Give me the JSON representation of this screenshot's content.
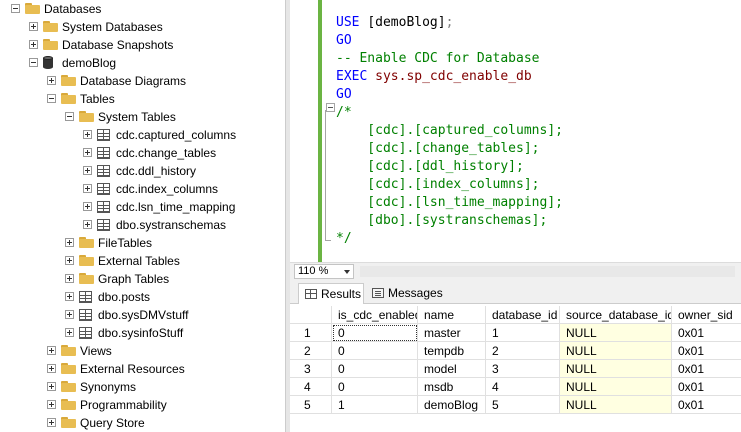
{
  "tree": {
    "items": [
      {
        "label": "Databases",
        "expander": "minus",
        "icon": "folder"
      },
      {
        "label": "System Databases",
        "expander": "plus",
        "icon": "folder"
      },
      {
        "label": "Database Snapshots",
        "expander": "plus",
        "icon": "folder"
      },
      {
        "label": "demoBlog",
        "expander": "minus",
        "icon": "database"
      },
      {
        "label": "Database Diagrams",
        "expander": "plus",
        "icon": "folder"
      },
      {
        "label": "Tables",
        "expander": "minus",
        "icon": "folder"
      },
      {
        "label": "System Tables",
        "expander": "minus",
        "icon": "folder"
      },
      {
        "label": "cdc.captured_columns",
        "expander": "plus",
        "icon": "table"
      },
      {
        "label": "cdc.change_tables",
        "expander": "plus",
        "icon": "table"
      },
      {
        "label": "cdc.ddl_history",
        "expander": "plus",
        "icon": "table"
      },
      {
        "label": "cdc.index_columns",
        "expander": "plus",
        "icon": "table"
      },
      {
        "label": "cdc.lsn_time_mapping",
        "expander": "plus",
        "icon": "table"
      },
      {
        "label": "dbo.systranschemas",
        "expander": "plus",
        "icon": "table"
      },
      {
        "label": "FileTables",
        "expander": "plus",
        "icon": "folder"
      },
      {
        "label": "External Tables",
        "expander": "plus",
        "icon": "folder"
      },
      {
        "label": "Graph Tables",
        "expander": "plus",
        "icon": "folder"
      },
      {
        "label": "dbo.posts",
        "expander": "plus",
        "icon": "table"
      },
      {
        "label": "dbo.sysDMVstuff",
        "expander": "plus",
        "icon": "table"
      },
      {
        "label": "dbo.sysinfoStuff",
        "expander": "plus",
        "icon": "table"
      },
      {
        "label": "Views",
        "expander": "plus",
        "icon": "folder"
      },
      {
        "label": "External Resources",
        "expander": "plus",
        "icon": "folder"
      },
      {
        "label": "Synonyms",
        "expander": "plus",
        "icon": "folder"
      },
      {
        "label": "Programmability",
        "expander": "plus",
        "icon": "folder"
      },
      {
        "label": "Query Store",
        "expander": "plus",
        "icon": "folder"
      }
    ]
  },
  "editor": {
    "lines": [
      {
        "parts": [
          {
            "t": "USE ",
            "c": "kw"
          },
          {
            "t": "[demoBlog]",
            "c": "pl"
          },
          {
            "t": ";",
            "c": "gy"
          }
        ]
      },
      {
        "parts": [
          {
            "t": "GO",
            "c": "kw"
          }
        ]
      },
      {
        "parts": [
          {
            "t": "-- Enable CDC for Database",
            "c": "cm"
          }
        ]
      },
      {
        "parts": [
          {
            "t": "EXEC ",
            "c": "kw"
          },
          {
            "t": "sys.sp_cdc_enable_db",
            "c": "fn"
          }
        ]
      },
      {
        "parts": [
          {
            "t": "GO",
            "c": "kw"
          }
        ]
      },
      {
        "parts": [
          {
            "t": "/*",
            "c": "cm"
          }
        ]
      },
      {
        "parts": [
          {
            "t": "    [cdc].[captured_columns];",
            "c": "cm"
          }
        ]
      },
      {
        "parts": [
          {
            "t": "    [cdc].[change_tables];",
            "c": "cm"
          }
        ]
      },
      {
        "parts": [
          {
            "t": "    [cdc].[ddl_history];",
            "c": "cm"
          }
        ]
      },
      {
        "parts": [
          {
            "t": "    [cdc].[index_columns];",
            "c": "cm"
          }
        ]
      },
      {
        "parts": [
          {
            "t": "    [cdc].[lsn_time_mapping];",
            "c": "cm"
          }
        ]
      },
      {
        "parts": [
          {
            "t": "    [dbo].[systranschemas];",
            "c": "cm"
          }
        ]
      },
      {
        "parts": [
          {
            "t": "*/",
            "c": "cm"
          }
        ]
      }
    ]
  },
  "zoom": {
    "value": "110 %"
  },
  "tabs": {
    "results": "Results",
    "messages": "Messages"
  },
  "grid": {
    "columns": [
      "",
      "is_cdc_enabled",
      "name",
      "database_id",
      "source_database_id",
      "owner_sid"
    ],
    "rows": [
      [
        "1",
        "0",
        "master",
        "1",
        "NULL",
        "0x01"
      ],
      [
        "2",
        "0",
        "tempdb",
        "2",
        "NULL",
        "0x01"
      ],
      [
        "3",
        "0",
        "model",
        "3",
        "NULL",
        "0x01"
      ],
      [
        "4",
        "0",
        "msdb",
        "4",
        "NULL",
        "0x01"
      ],
      [
        "5",
        "1",
        "demoBlog",
        "5",
        "NULL",
        "0x01"
      ]
    ]
  },
  "colors": {
    "accent_margin": "#6bb443",
    "null_cell": "#ffffe1",
    "folder": "#e8bd52"
  }
}
